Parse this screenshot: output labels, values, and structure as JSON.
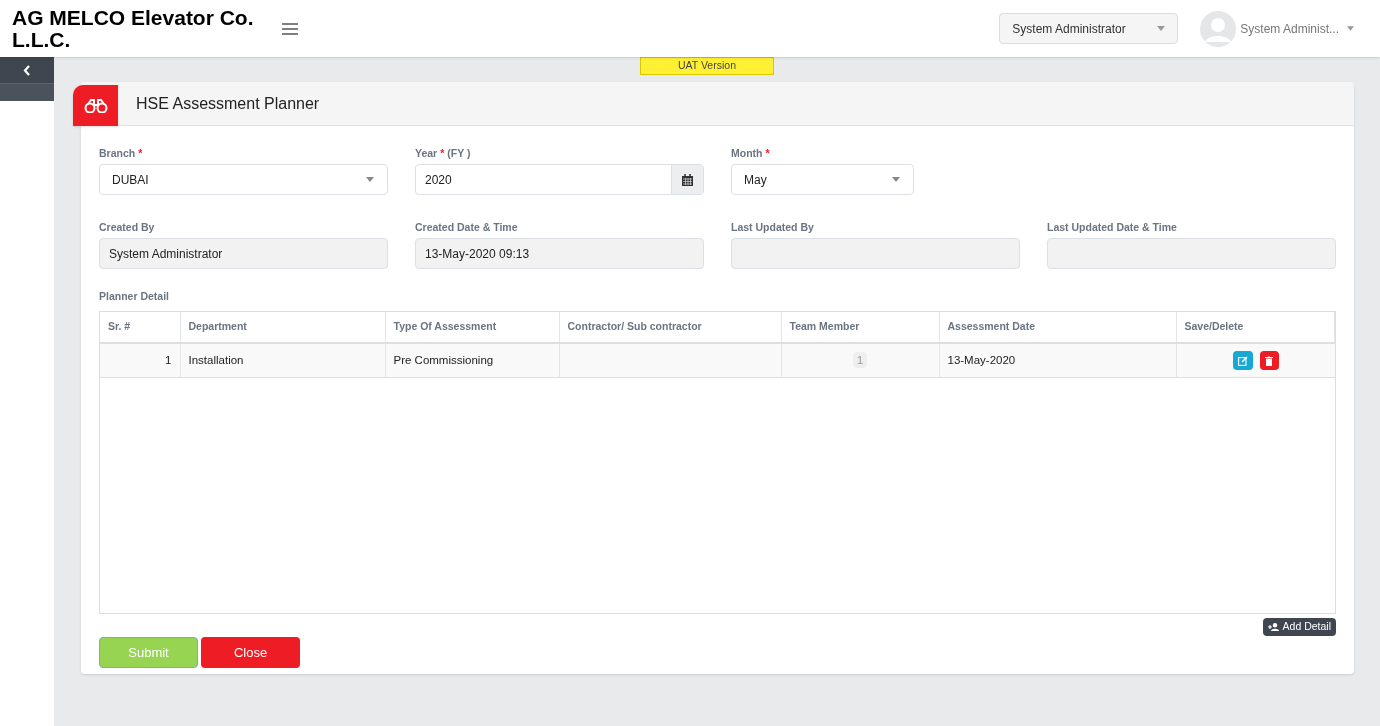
{
  "header": {
    "company": "AG MELCO Elevator Co. L.L.C.",
    "role_select": "System Administrator",
    "user": "System Administ..."
  },
  "version_badge": "UAT Version",
  "page_title": "HSE Assessment Planner",
  "sidebar": {
    "collapsed": true
  },
  "field_rows": [
    [
      {
        "label": "Branch",
        "required_mark": "*",
        "kind": "select",
        "value": "DUBAI",
        "readonly": false
      },
      {
        "label": "Year",
        "required_mark": "*",
        "suffix": "(FY )",
        "kind": "date",
        "value": "2020",
        "readonly": false
      },
      {
        "label": "Month",
        "required_mark": "*",
        "kind": "select",
        "value": "May",
        "readonly": false
      }
    ],
    [
      {
        "label": "Created By",
        "kind": "text",
        "value": "System Administrator",
        "readonly": true
      },
      {
        "label": "Created Date & Time",
        "kind": "text",
        "value": "13-May-2020 09:13",
        "readonly": true
      },
      {
        "label": "Last Updated By",
        "kind": "text",
        "readonly": true
      },
      {
        "label": "Last Updated Date & Time",
        "kind": "text",
        "readonly": true
      }
    ]
  ],
  "planner_detail": {
    "title": "Planner Detail",
    "columns": [
      "Sr. #",
      "Department",
      "Type Of Assessment",
      "Contractor/ Sub contractor",
      "Team Member",
      "Assessment Date",
      "Save/Delete"
    ],
    "rows": [
      {
        "sr": "1",
        "department": "Installation",
        "type": "Pre Commissioning",
        "team_member": "1",
        "date": "13-May-2020"
      }
    ],
    "add_button": "Add Detail"
  },
  "buttons": [
    {
      "label": "Submit",
      "kind": "submit"
    },
    {
      "label": "Close",
      "kind": "close"
    }
  ]
}
